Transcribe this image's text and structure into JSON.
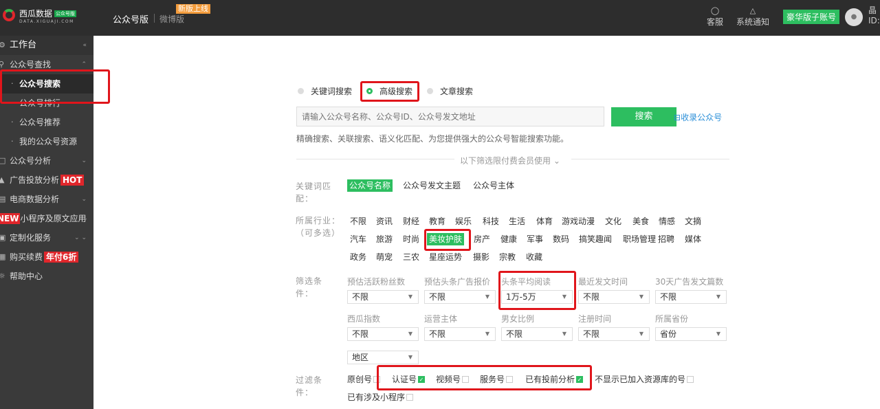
{
  "header": {
    "brand_name": "西瓜数据",
    "brand_tag": "公众号版",
    "brand_domain": "DATA.XIGUAJI.COM",
    "nav_wechat": "公众号版",
    "nav_weibo": "微博版",
    "new_badge": "新版上线",
    "service_label": "客服",
    "notify_label": "系统通知",
    "vip_label": "豪华版子账号",
    "user_line1": "晶",
    "user_line2": "ID:"
  },
  "sidebar": {
    "workbench": "工作台",
    "items": [
      {
        "label": "公众号查找"
      },
      {
        "label": "公众号搜索"
      },
      {
        "label": "公众号排行"
      },
      {
        "label": "公众号推荐"
      },
      {
        "label": "我的公众号资源"
      },
      {
        "label": "公众号分析"
      },
      {
        "label": "广告投放分析",
        "tag": "HOT"
      },
      {
        "label": "电商数据分析"
      },
      {
        "label": "小程序及原文应用",
        "tag": "NEW"
      },
      {
        "label": "定制化服务"
      },
      {
        "label": "购买续费",
        "tag": "年付6折"
      },
      {
        "label": "帮助中心"
      }
    ]
  },
  "search": {
    "modes": [
      "关键词搜索",
      "高级搜索",
      "文章搜索"
    ],
    "active_mode": "高级搜索",
    "placeholder": "请输入公众号名称、公众号ID、公众号发文地址",
    "button": "搜索",
    "collect_link": "收录公众号",
    "description": "精确搜索、关联搜索、语义化匹配、为您提供强大的公众号智能搜索功能。",
    "members_divider": "以下筛选限付费会员使用"
  },
  "keyword_match": {
    "label": "关键词匹配：",
    "options": [
      "公众号名称",
      "公众号发文主题",
      "公众号主体"
    ],
    "selected": "公众号名称"
  },
  "industry": {
    "label": "所属行业：（可多选）",
    "rows": [
      [
        "不限",
        "资讯",
        "财经",
        "教育",
        "娱乐",
        "科技",
        "生活",
        "体育",
        "游戏动漫",
        "文化",
        "美食",
        "情感",
        "文摘"
      ],
      [
        "汽车",
        "旅游",
        "时尚",
        "美妆护肤",
        "房产",
        "健康",
        "军事",
        "数码",
        "搞笑趣闻",
        "职场管理",
        "招聘",
        "媒体"
      ],
      [
        "政务",
        "萌宠",
        "三农",
        "星座运势",
        "摄影",
        "宗教",
        "收藏"
      ]
    ],
    "selected": "美妆护肤"
  },
  "filters": {
    "label": "筛选条件：",
    "fields": [
      {
        "label": "预估活跃粉丝数",
        "value": "不限"
      },
      {
        "label": "预估头条广告报价",
        "value": "不限"
      },
      {
        "label": "头条平均阅读",
        "value": "1万-5万"
      },
      {
        "label": "最近发文时间",
        "value": "不限"
      },
      {
        "label": "30天广告发文篇数",
        "value": "不限"
      },
      {
        "label": "西瓜指数",
        "value": "不限"
      },
      {
        "label": "运营主体",
        "value": "不限"
      },
      {
        "label": "男女比例",
        "value": "不限"
      },
      {
        "label": "注册时间",
        "value": "不限"
      },
      {
        "label": "所属省份",
        "value": "省份"
      },
      {
        "label": "",
        "value": "地区"
      }
    ]
  },
  "exclude": {
    "label": "过滤条件：",
    "items": [
      {
        "label": "原创号",
        "checked": false
      },
      {
        "label": "认证号",
        "checked": true
      },
      {
        "label": "视频号",
        "checked": false
      },
      {
        "label": "服务号",
        "checked": false
      },
      {
        "label": "已有投前分析",
        "checked": true
      },
      {
        "label": "不显示已加入资源库的号",
        "checked": false
      },
      {
        "label": "已有涉及小程序",
        "checked": false
      }
    ]
  },
  "colors": {
    "accent": "#2dbe60",
    "highlight": "#e0151b",
    "link": "#2b8fd8",
    "topbar": "#2d2d2d",
    "sidebar": "#3a3a3a"
  }
}
